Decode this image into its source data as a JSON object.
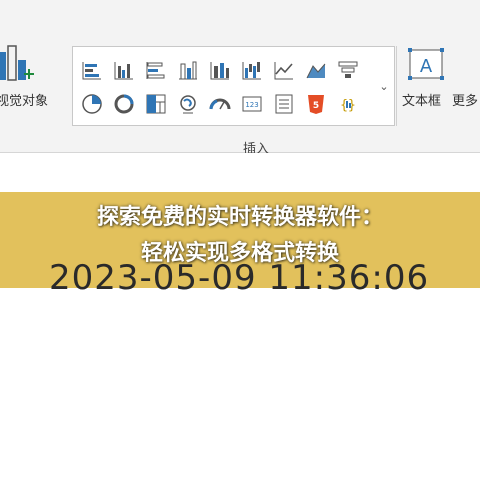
{
  "ribbon": {
    "visual_object_label": "视觉对象",
    "group_label": "插入",
    "textbox_label": "文本框",
    "more_label": "更多",
    "textbox_glyph": "A",
    "scroll_glyph": "⌄",
    "gallery_icons": [
      "stacked-bar-chart-icon",
      "clustered-bar-chart-icon",
      "stacked-bar-horizontal-icon",
      "column-chart-icon",
      "stacked-column-chart-icon",
      "waterfall-chart-icon",
      "line-chart-icon",
      "area-chart-icon",
      "funnel-chart-icon",
      "pie-chart-icon",
      "donut-chart-icon",
      "treemap-icon",
      "map-icon",
      "gauge-icon",
      "card-icon",
      "multi-row-card-icon",
      "html-icon",
      "json-icon"
    ]
  },
  "document": {
    "timestamp": "2023-05-09 11:36:06"
  },
  "banner": {
    "line1": "探索免费的实时转换器软件：",
    "line2": "轻松实现多格式转换"
  },
  "colors": {
    "banner": "#deb846",
    "accent_blue": "#2f75b5",
    "ribbon_bg": "#f3f3f3"
  }
}
